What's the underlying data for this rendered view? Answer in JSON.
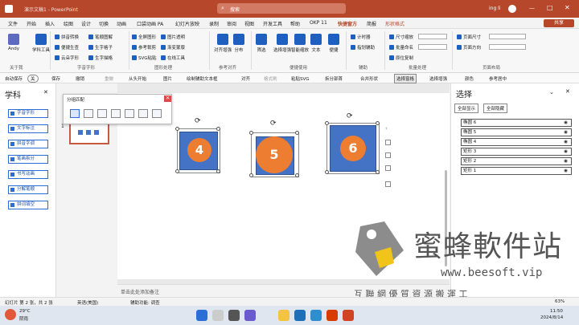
{
  "titlebar": {
    "quick": "自动保存",
    "doc_title": "演示文稿1 - PowerPoint",
    "search_placeholder": "搜索",
    "user": "ing li",
    "win_min": "—",
    "win_max": "□",
    "win_close": "✕"
  },
  "menu": [
    "文件",
    "开始",
    "插入",
    "绘图",
    "设计",
    "切换",
    "动画",
    "口袋动画 PA",
    "幻灯片放映",
    "录制",
    "审阅",
    "视图",
    "开发工具",
    "帮助",
    "OKP 11",
    "快捷窗方",
    "简报",
    "形状格式"
  ],
  "menu_active": "快捷窗方",
  "share": "共享",
  "ribbon": {
    "about": "Andy",
    "learn": "学科工具",
    "group_about": "关于我",
    "char_items": [
      "拼音转换",
      "笔顺图解",
      "便捷生查",
      "生字格子",
      "云朵字形",
      "生字描格"
    ],
    "group_char": "字音字形",
    "shape_items": [
      "全屏图形",
      "图片透明",
      "参考裁剪",
      "渐变蒙版",
      "SVG粘贴",
      "在线工具"
    ],
    "group_shape": "图形处理",
    "align": "对齐增强",
    "distribute": "分布",
    "group_ref": "参考对齐",
    "filter": "筛选",
    "select": "选择增强",
    "sizes": "智能缩放",
    "text": "文本",
    "convenient": "便捷",
    "group_fast": "便捷使用",
    "aux": [
      "计时器",
      "指划辅助"
    ],
    "group_aux": "辅助",
    "batch": [
      "尺寸缩放",
      "批量命名",
      "原位复制"
    ],
    "group_batch": "批量处理",
    "layout": [
      "页面尺寸",
      "页面方向"
    ],
    "group_layout": "页面布局"
  },
  "qat": [
    "自动保存",
    "关",
    "保存",
    "撤销",
    "重做",
    "从头开始",
    "图片",
    "绘制辅助文本框",
    "对齐",
    "格式刷",
    "粘贴SVG",
    "拆分部首",
    "合并形状",
    "选择窗格",
    "选择增强",
    "颜色",
    "参考居中"
  ],
  "left_pane": {
    "title": "学科",
    "buttons": [
      "字音字形",
      "文字标注",
      "拼音字调",
      "笔画拆分",
      "书写动画",
      "分解笔顺",
      "拼词填空"
    ]
  },
  "popup": {
    "title": "分组匹配",
    "close": "×"
  },
  "slide_number": "1",
  "shapes": [
    {
      "label": "4"
    },
    {
      "label": "5"
    },
    {
      "label": "6"
    }
  ],
  "notes": "单击此处添加备注",
  "right_pane": {
    "title": "选择",
    "show_all": "全部显示",
    "hide_all": "全部隐藏",
    "layers": [
      "椭圆 6",
      "椭圆 5",
      "椭圆 4",
      "矩形 3",
      "矩形 2",
      "矩形 1"
    ]
  },
  "status": {
    "slide": "幻灯片 第 2 张，共 2 张",
    "lang": "英语(美国)",
    "access": "辅助功能: 调查",
    "zoom": "63%"
  },
  "taskbar": {
    "temp": "29°C",
    "weather": "阴雨",
    "time": "11:50",
    "date": "2024/8/14"
  },
  "watermark": {
    "brand": "蜜蜂軟件站",
    "url": "www.beesoft.vip",
    "slogan": "互 聯 網 優 質 資 源 搬 運 工"
  }
}
